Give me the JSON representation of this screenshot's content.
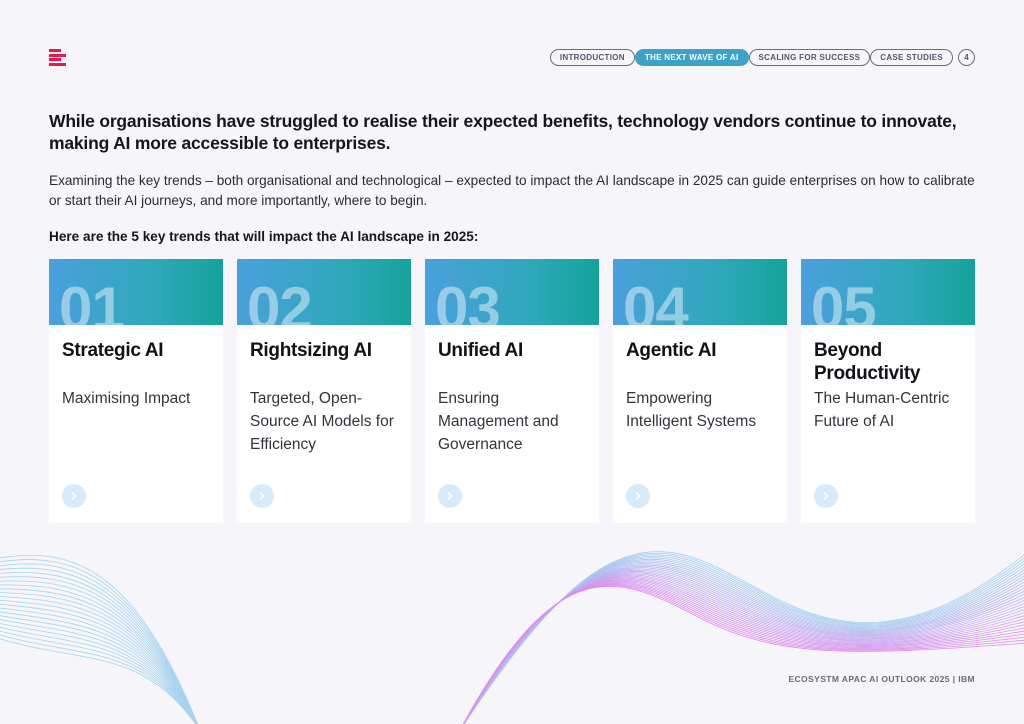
{
  "nav": {
    "items": [
      {
        "label": "INTRODUCTION",
        "active": false
      },
      {
        "label": "THE NEXT WAVE OF AI",
        "active": true
      },
      {
        "label": "SCALING FOR SUCCESS",
        "active": false
      },
      {
        "label": "CASE STUDIES",
        "active": false
      }
    ],
    "page_number": "4"
  },
  "headline": "While organisations have struggled to realise their expected benefits, technology vendors continue to innovate, making AI more accessible to enterprises.",
  "body": "Examining the key trends – both organisational and technological – expected to impact the AI landscape in 2025 can guide enterprises on how to calibrate or start their AI journeys, and more importantly, where to begin.",
  "trends_intro": "Here are the 5 key trends that will impact the AI landscape in 2025:",
  "cards": [
    {
      "number": "01",
      "title": "Strategic AI",
      "description": "Maximising Impact"
    },
    {
      "number": "02",
      "title": "Rightsizing AI",
      "description": "Targeted, Open-Source AI Models for Efficiency"
    },
    {
      "number": "03",
      "title": "Unified AI",
      "description": "Ensuring Management and Governance"
    },
    {
      "number": "04",
      "title": "Agentic AI",
      "description": "Empowering Intelligent Systems"
    },
    {
      "number": "05",
      "title": "Beyond Productivity",
      "description": "The Human-Centric Future of AI"
    }
  ],
  "footer": "ECOSYSTM APAC AI OUTLOOK 2025 | IBM",
  "colors": {
    "accent_red": "#e8184c",
    "nav_active": "#3da2c7",
    "card_gradient_start": "#4aa0dc",
    "card_gradient_end": "#14a39a",
    "arrow_bg": "#d6ecfa",
    "wave_blue": "#8cc8ec",
    "wave_purple": "#c07ae8"
  },
  "icons": {
    "logo": "ecosystm-logo-icon",
    "card_arrow": "chevron-right-icon"
  }
}
